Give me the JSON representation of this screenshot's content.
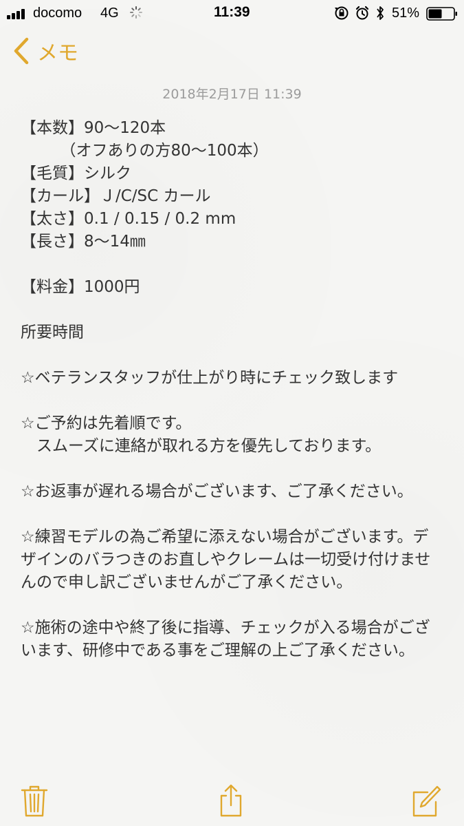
{
  "status_bar": {
    "carrier": "docomo",
    "network": "4G",
    "time": "11:39",
    "battery_percent": "51%",
    "icons": [
      "signal-icon",
      "activity-spinner-icon",
      "orientation-lock-icon",
      "alarm-icon",
      "bluetooth-icon",
      "battery-icon"
    ]
  },
  "nav": {
    "back_label": "メモ"
  },
  "note": {
    "date": "2018年2月17日 11:39",
    "lines": [
      "【本数】90〜120本",
      "　　　（オフありの方80〜100本）",
      "【毛質】シルク",
      "【カール】Ｊ/C/SC カール",
      "【太さ】0.1 / 0.15 / 0.2 mm",
      "【長さ】8〜14㎜",
      "",
      "【料金】1000円",
      "",
      "所要時間",
      "",
      "☆ベテランスタッフが仕上がり時にチェック致します",
      "",
      "☆ご予約は先着順です。",
      "　スムーズに連絡が取れる方を優先しております。",
      "",
      "☆お返事が遅れる場合がございます、ご了承ください。",
      "",
      "☆練習モデルの為ご希望に添えない場合がございます。デ",
      "ザインのバラつきのお直しやクレームは一切受け付けませ",
      "んので申し訳ございませんがご了承ください。",
      "",
      "☆施術の途中や終了後に指導、チェックが入る場合がござ",
      "います、研修中である事をご理解の上ご了承ください。"
    ]
  },
  "toolbar": {
    "icons": [
      "trash-icon",
      "share-icon",
      "compose-icon"
    ]
  },
  "colors": {
    "accent": "#e0a82e",
    "text": "#333333",
    "date": "#9b9b9b",
    "background": "#f5f5f3"
  }
}
